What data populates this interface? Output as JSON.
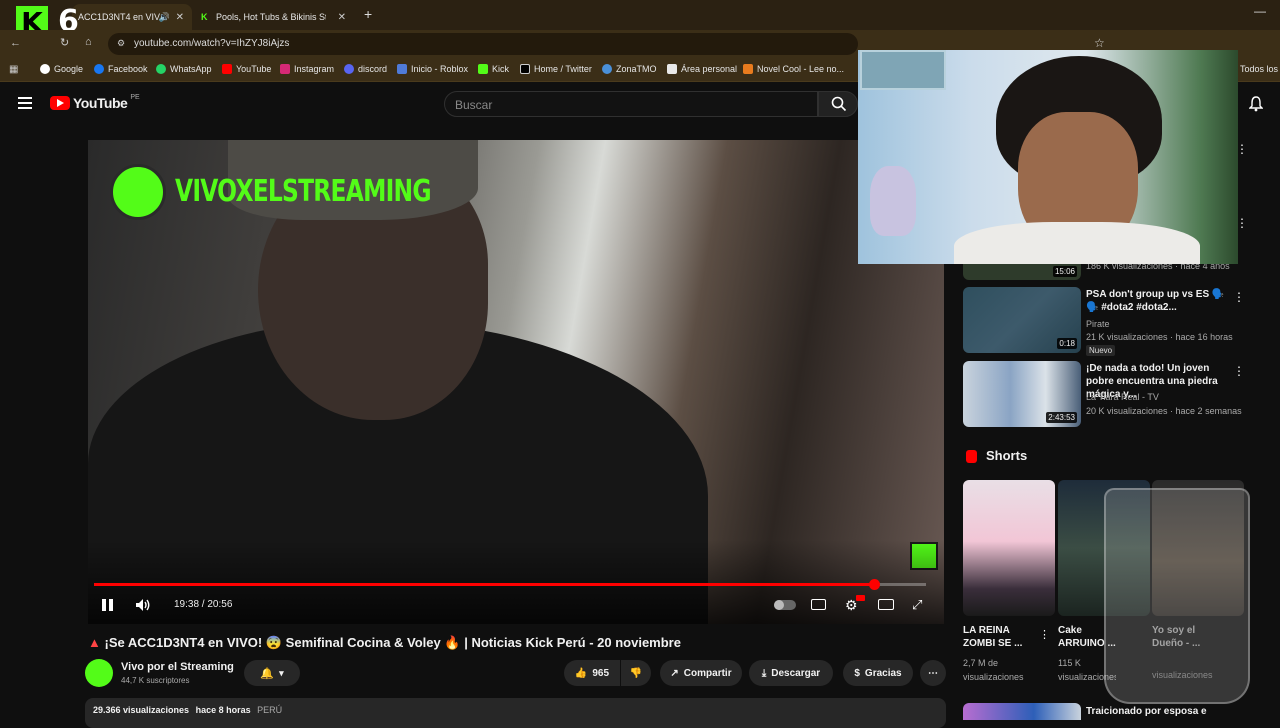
{
  "browser": {
    "tabs": [
      {
        "label": "ACC1D3NT4 en VIV",
        "active": true
      },
      {
        "label": "Pools, Hot Tubs & Bikinis Stream",
        "active": false
      }
    ],
    "url": "youtube.com/watch?v=IhZYJ8iAjzs",
    "bookmarks": [
      "Google",
      "Facebook",
      "WhatsApp",
      "YouTube",
      "Instagram",
      "discord",
      "Inicio - Roblox",
      "Kick",
      "Home / Twitter",
      "ZonaTMO",
      "Área personal",
      "Novel Cool - Lee no..."
    ],
    "other_bookmarks": "Todos los",
    "kick_overlay_number": "6"
  },
  "youtube": {
    "logo": "YouTube",
    "region": "PE",
    "search_placeholder": "Buscar"
  },
  "player": {
    "overlay_channel": "VIVOXELSTREAMING",
    "time": "19:38 / 20:56",
    "progress": 0.9375
  },
  "video": {
    "title_prefix": "¡Se ACC1D3NT4 en VIVO!",
    "title_mid": "Semifinal Cocina & Voley",
    "title_suffix": "| Noticias Kick Perú - 20 noviembre",
    "channel": "Vivo por el Streaming",
    "subscribers": "44,7 K suscriptores",
    "likes": "965",
    "share": "Compartir",
    "download": "Descargar",
    "thanks": "Gracias",
    "views": "29.366 visualizaciones",
    "ago": "hace 8 horas",
    "country": "PERÚ"
  },
  "sidebar": {
    "items": [
      {
        "title": "",
        "channel": "",
        "meta": "186 K visualizaciones · hace 4 años",
        "duration": "15:06"
      },
      {
        "title": "PSA don't group up vs ES 🗣️🗣️ #dota2 #dota2...",
        "channel": "Pirate",
        "meta": "21 K visualizaciones · hace 16 horas",
        "badge": "Nuevo",
        "duration": "0:18"
      },
      {
        "title": "¡De nada a todo! Un joven pobre encuentra una piedra mágica y...",
        "channel": "La Tiara Real - TV",
        "meta": "20 K visualizaciones · hace 2 semanas",
        "duration": "2:43:53"
      }
    ],
    "shorts_label": "Shorts",
    "shorts": [
      {
        "title": "LA REINA ZOMBI SE ...",
        "views": "2,7 M de visualizaciones"
      },
      {
        "title": "Cake ARRUINO ...",
        "views": "115 K visualizaciones"
      },
      {
        "title": "Yo soy el Dueño - ...",
        "views": "visualizaciones"
      }
    ],
    "next_title": "Traicionado por esposa e"
  }
}
